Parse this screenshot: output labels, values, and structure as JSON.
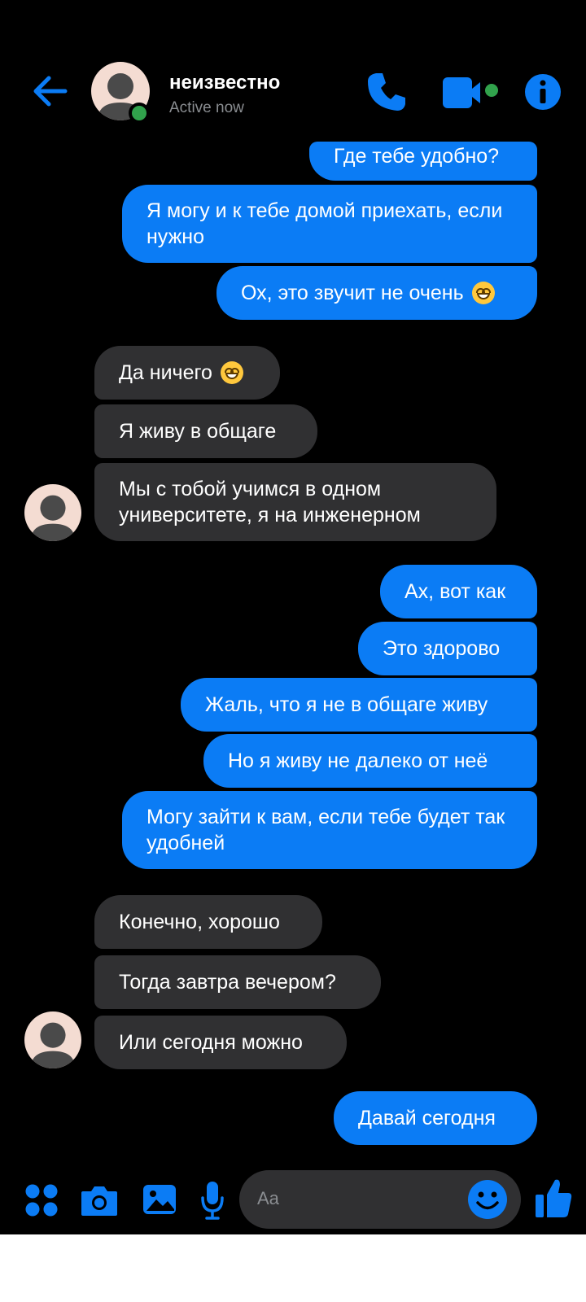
{
  "header": {
    "contact_name": "неизвестно",
    "status": "Active now",
    "icons": [
      "back-arrow-icon",
      "phone-icon",
      "video-camera-icon",
      "info-icon"
    ]
  },
  "messages": [
    {
      "dir": "out",
      "text": "Где тебе удобно?"
    },
    {
      "dir": "out",
      "text": "Я могу и к тебе домой приехать, если нужно"
    },
    {
      "dir": "out",
      "text": "Ох, это звучит не очень",
      "emoji": "grinning-squinting-face"
    },
    {
      "dir": "in",
      "text": "Да ничего",
      "emoji": "grinning-squinting-face"
    },
    {
      "dir": "in",
      "text": "Я живу в общаге"
    },
    {
      "dir": "in",
      "text": "Мы с тобой учимся в одном университете, я на инженерном"
    },
    {
      "dir": "out",
      "text": "Ах, вот как"
    },
    {
      "dir": "out",
      "text": "Это здорово"
    },
    {
      "dir": "out",
      "text": "Жаль, что я не в общаге живу"
    },
    {
      "dir": "out",
      "text": "Но я живу не далеко от неё"
    },
    {
      "dir": "out",
      "text": "Могу зайти к вам, если тебе будет так удобней"
    },
    {
      "dir": "in",
      "text": "Конечно, хорошо"
    },
    {
      "dir": "in",
      "text": "Тогда завтра вечером?"
    },
    {
      "dir": "in",
      "text": "Или сегодня можно"
    },
    {
      "dir": "out",
      "text": "Давай сегодня"
    }
  ],
  "composer": {
    "placeholder": "Aa",
    "icons": [
      "menu-dots-icon",
      "camera-icon",
      "image-icon",
      "microphone-icon",
      "emoji-icon",
      "thumbs-up-icon"
    ]
  },
  "colors": {
    "accent": "#0b7cf5",
    "outgoing_bubble": "#0b7cf5",
    "incoming_bubble": "#303032",
    "online": "#31a24c",
    "background": "#000000"
  }
}
